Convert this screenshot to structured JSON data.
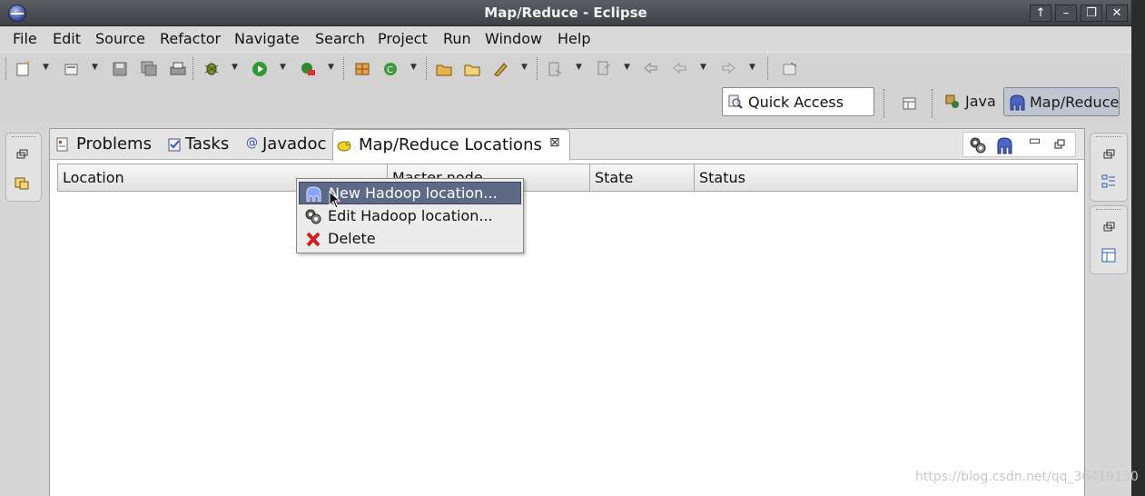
{
  "window": {
    "title": "Map/Reduce - Eclipse"
  },
  "menubar": {
    "items": [
      {
        "label": "File"
      },
      {
        "label": "Edit"
      },
      {
        "label": "Source"
      },
      {
        "label": "Refactor"
      },
      {
        "label": "Navigate"
      },
      {
        "label": "Search"
      },
      {
        "label": "Project"
      },
      {
        "label": "Run"
      },
      {
        "label": "Window"
      },
      {
        "label": "Help"
      }
    ]
  },
  "toolbar2": {
    "quick_access": "Quick Access",
    "perspectives": [
      {
        "label": "Java",
        "icon": "java-perspective-icon"
      },
      {
        "label": "Map/Reduce",
        "icon": "elephant-icon",
        "active": true
      }
    ]
  },
  "view": {
    "tabs": [
      {
        "label": "Problems",
        "icon": "problems-icon"
      },
      {
        "label": "Tasks",
        "icon": "tasks-icon"
      },
      {
        "label": "Javadoc",
        "icon": "at-icon"
      },
      {
        "label": "Map/Reduce Locations",
        "icon": "hadoop-icon",
        "active": true
      }
    ],
    "columns": [
      "Location",
      "Master node",
      "State",
      "Status"
    ]
  },
  "context_menu": {
    "items": [
      {
        "label": "New Hadoop location...",
        "icon": "elephant-icon",
        "highlighted": true
      },
      {
        "label": "Edit Hadoop location...",
        "icon": "gears-icon"
      },
      {
        "label": "Delete",
        "icon": "red-x-icon"
      }
    ]
  },
  "watermark": "https://blog.csdn.net/qq_36419130",
  "colors": {
    "title_bar": "#4a4d52",
    "menu_highlight": "#5d6a86",
    "workspace": "#d6d6d6"
  }
}
